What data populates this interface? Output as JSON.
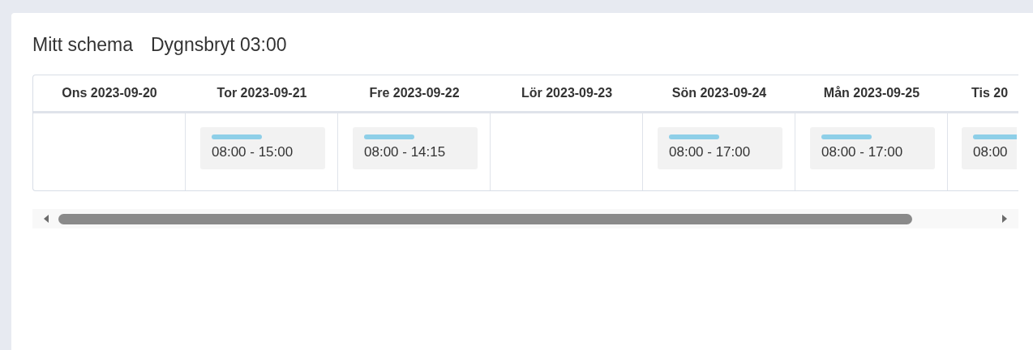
{
  "title": "Mitt schema",
  "day_break": "Dygnsbryt 03:00",
  "days": [
    {
      "label": "Ons 2023-09-20"
    },
    {
      "label": "Tor 2023-09-21",
      "shift": {
        "time": "08:00 - 15:00"
      }
    },
    {
      "label": "Fre 2023-09-22",
      "shift": {
        "time": "08:00 - 14:15"
      }
    },
    {
      "label": "Lör 2023-09-23"
    },
    {
      "label": "Sön 2023-09-24",
      "shift": {
        "time": "08:00 - 17:00"
      }
    },
    {
      "label": "Mån 2023-09-25",
      "shift": {
        "time": "08:00 - 17:00"
      }
    },
    {
      "label": "Tis 20",
      "shift": {
        "time": "08:00"
      }
    }
  ]
}
